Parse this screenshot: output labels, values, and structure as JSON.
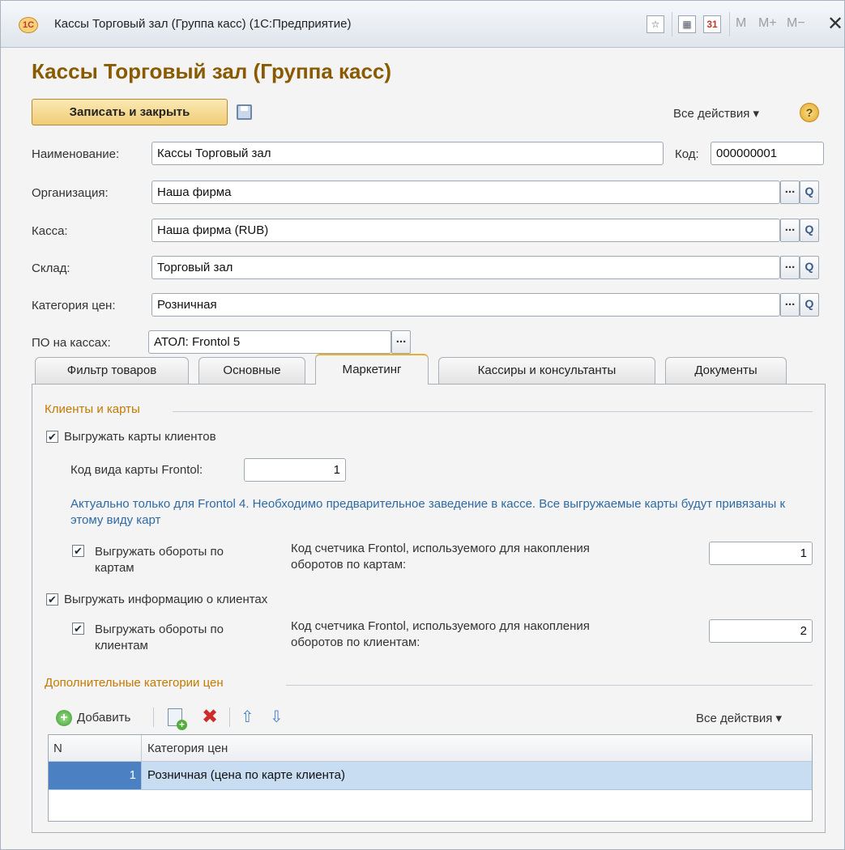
{
  "window": {
    "title": "Кассы Торговый зал (Группа касс)  (1С:Предприятие)",
    "logo_text": "1С",
    "buttons": [
      "M",
      "M+",
      "M−"
    ]
  },
  "form": {
    "title": "Кассы Торговый зал (Группа касс)",
    "save_close_label": "Записать и закрыть",
    "all_actions_label": "Все действия ▾",
    "help_label": "?"
  },
  "fields": {
    "name_label": "Наименование:",
    "name_value": "Кассы Торговый зал",
    "code_label": "Код:",
    "code_value": "000000001",
    "org_label": "Организация:",
    "org_value": "Наша фирма",
    "cash_label": "Касса:",
    "cash_value": "Наша фирма (RUB)",
    "warehouse_label": "Склад:",
    "warehouse_value": "Торговый зал",
    "price_cat_label": "Категория цен:",
    "price_cat_value": "Розничная",
    "software_label": "ПО на кассах:",
    "software_value": "АТОЛ: Frontol 5",
    "pick_label": "...",
    "search_label": "Q"
  },
  "tabs": [
    {
      "label": "Фильтр товаров"
    },
    {
      "label": "Основные"
    },
    {
      "label": "Маркетинг",
      "active": true
    },
    {
      "label": "Кассиры и консультанты"
    },
    {
      "label": "Документы"
    }
  ],
  "marketing": {
    "group_clients": "Клиенты и карты",
    "export_cards_label": "Выгружать карты клиентов",
    "export_cards_checked": true,
    "card_type_label": "Код вида карты Frontol:",
    "card_type_value": "1",
    "note": "Актуально только для Frontol 4. Необходимо предварительное заведение в кассе. Все выгружаемые карты будут привязаны к этому виду карт",
    "export_card_turnover_label_1": "Выгружать обороты по",
    "export_card_turnover_label_2": "картам",
    "export_card_turnover_checked": true,
    "card_counter_label_1": "Код счетчика Frontol, используемого для накопления",
    "card_counter_label_2": "оборотов по картам:",
    "card_counter_value": "1",
    "export_clients_info_label": "Выгружать информацию о клиентах",
    "export_clients_info_checked": true,
    "export_client_turnover_label_1": "Выгружать обороты по",
    "export_client_turnover_label_2": "клиентам",
    "export_client_turnover_checked": true,
    "client_counter_label_1": "Код счетчика Frontol, используемого для накопления",
    "client_counter_label_2": "оборотов по клиентам:",
    "client_counter_value": "2",
    "group_additional": "Дополнительные категории цен",
    "add_label": "Добавить",
    "all_actions_label": "Все действия ▾",
    "table": {
      "columns": [
        "N",
        "Категория цен"
      ],
      "rows": [
        {
          "n": "1",
          "category": "Розничная (цена по карте клиента)"
        }
      ]
    }
  },
  "colors": {
    "title_accent": "#8a5a00",
    "group_title": "#c37a00",
    "note_text": "#2d6aa6",
    "selected_row": "#c8ddf2"
  }
}
